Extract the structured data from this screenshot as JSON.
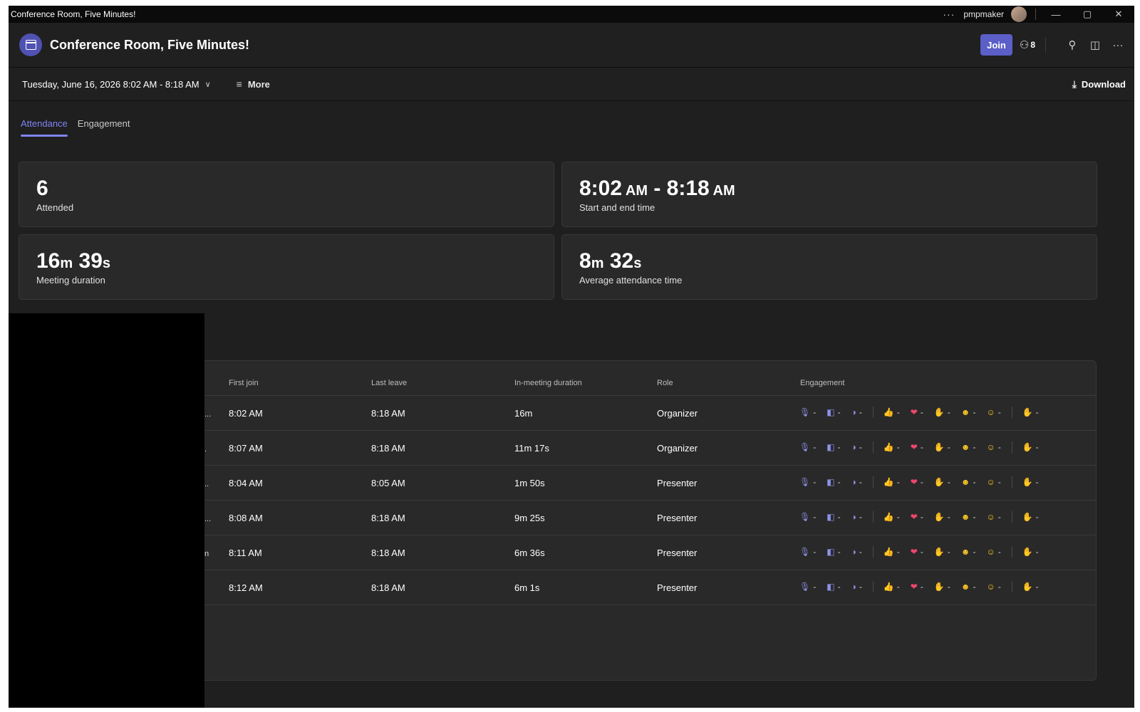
{
  "window": {
    "title": "Conference Room, Five Minutes!",
    "user": "pmpmaker",
    "dots": "···",
    "minimize": "—",
    "maximize": "▢",
    "close": "✕"
  },
  "header": {
    "title": "Conference Room, Five Minutes!",
    "join_label": "Join",
    "participants_count": "8",
    "icons": [
      "calendar-icon",
      "people-icon",
      "search-icon",
      "side-panel-icon",
      "more-options-icon"
    ]
  },
  "toolbar": {
    "date_range": "Tuesday, June 16, 2026 8:02 AM - 8:18 AM",
    "more_label": "More",
    "download_label": "Download"
  },
  "tabs": [
    {
      "label": "Attendance",
      "active": true
    },
    {
      "label": "Engagement",
      "active": false
    }
  ],
  "cards": {
    "attended": {
      "value": "6",
      "label": "Attended"
    },
    "time": {
      "start": "8:02",
      "start_unit": "AM",
      "sep": " - ",
      "end": "8:18",
      "end_unit": "AM",
      "label": "Start and end time"
    },
    "duration": {
      "m": "16",
      "m_unit": "m",
      "s": "39",
      "s_unit": "s",
      "label": "Meeting duration"
    },
    "average": {
      "m": "8",
      "m_unit": "m",
      "s": "32",
      "s_unit": "s",
      "label": "Average attendance time"
    }
  },
  "table": {
    "headers": {
      "first_join": "First join",
      "last_leave": "Last leave",
      "duration": "In-meeting duration",
      "role": "Role",
      "engagement": "Engagement"
    },
    "engagement_dash": "-",
    "rows": [
      {
        "first_join": "8:02 AM",
        "last_leave": "8:18 AM",
        "duration": "16m",
        "role": "Organizer",
        "edge": "..."
      },
      {
        "first_join": "8:07 AM",
        "last_leave": "8:18 AM",
        "duration": "11m 17s",
        "role": "Organizer",
        "edge": "."
      },
      {
        "first_join": "8:04 AM",
        "last_leave": "8:05 AM",
        "duration": "1m 50s",
        "role": "Presenter",
        "edge": ".."
      },
      {
        "first_join": "8:08 AM",
        "last_leave": "8:18 AM",
        "duration": "9m 25s",
        "role": "Presenter",
        "edge": "..."
      },
      {
        "first_join": "8:11 AM",
        "last_leave": "8:18 AM",
        "duration": "6m 36s",
        "role": "Presenter",
        "edge": "n"
      },
      {
        "first_join": "8:12 AM",
        "last_leave": "8:18 AM",
        "duration": "6m 1s",
        "role": "Presenter",
        "edge": ""
      }
    ]
  },
  "colors": {
    "accent": "#7f85f5",
    "join_button": "#5b5fc7",
    "background": "#1f1f1f",
    "card": "#292929"
  }
}
